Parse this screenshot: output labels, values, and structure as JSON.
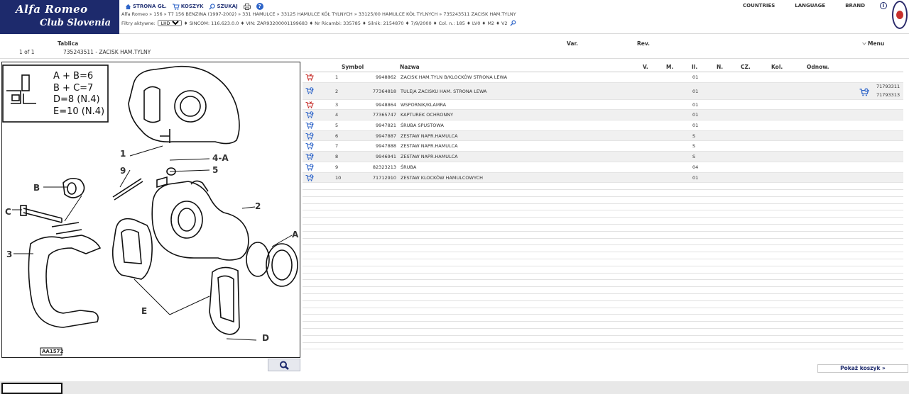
{
  "logo": {
    "line1": "Alfa Romeo",
    "line2": "Club Slovenia"
  },
  "nav": {
    "home": "STRONA GŁ.",
    "cart": "KOSZYK",
    "search": "SZUKAJ",
    "help": "?"
  },
  "right_nav": {
    "countries": "COUNTRIES",
    "language": "LANGUAGE",
    "brand": "BRAND",
    "info": "i"
  },
  "breadcrumb": "Alfa Romeo » 156 » T7 156 BENZINA (1997-2002) » 331 HAMULCE » 33125 HAMULCE KÓŁ TYLNYCH » 33125/00 HAMULCE KÓŁ TYLNYCH » 735243511 ZACISK HAM.TYLNY",
  "filters": {
    "label": "Filtry aktywne:",
    "select_value": "LHD",
    "items": "♦ SINCOM: 116.623.0.0 ♦ VIN: ZAR93200001199683 ♦ Nr Ricambi: 335785 ♦ Silnik: 2154870 ♦ 7/9/2000 ♦ Col. n.: 185 ♦ LV0 ♦ M2 ♦ V2"
  },
  "header": {
    "tablica": "Tablica",
    "var": "Var.",
    "rev": "Rev.",
    "menu": "Menu",
    "page": "1 of 1",
    "table_title": "735243511 - ZACISK HAM.TYLNY"
  },
  "diagram": {
    "legend": [
      "A + B=6",
      "B + C=7",
      "D=8  (N.4)",
      "E=10  (N.4)"
    ],
    "labels": {
      "l1": "1",
      "l2": "2",
      "l3": "3",
      "l4a": "4-A",
      "l5": "5",
      "l9": "9",
      "la": "A",
      "lb": "B",
      "lc": "C",
      "ld": "D",
      "le": "E"
    },
    "code": "AA1572"
  },
  "table": {
    "columns": {
      "symbol": "Symbol",
      "nazwa": "Nazwa",
      "v": "V.",
      "m": "M.",
      "il": "Il.",
      "n": "N.",
      "cz": "CZ.",
      "kol": "Kol.",
      "odnow": "Odnow."
    },
    "rows": [
      {
        "num": "1",
        "symbol": "9948862",
        "nazwa": "ZACISK HAM.TYLN B/KLOCKÓW STRONA LEWA",
        "il": "01"
      },
      {
        "num": "2",
        "symbol": "77364818",
        "nazwa": "TULEJA ZACISKU HAM. STRONA LEWA",
        "il": "01",
        "odnow1": "71793311",
        "odnow2": "71793313"
      },
      {
        "num": "3",
        "symbol": "9948864",
        "nazwa": "WSPORNIK/KLAMRA",
        "il": "01"
      },
      {
        "num": "4",
        "symbol": "77365747",
        "nazwa": "KAPTUREK OCHRONNY",
        "il": "01"
      },
      {
        "num": "5",
        "symbol": "9947821",
        "nazwa": "ŚRUBA SPUSTOWA",
        "il": "01"
      },
      {
        "num": "6",
        "symbol": "9947887",
        "nazwa": "ZESTAW NAPR.HAMULCA",
        "il": "S"
      },
      {
        "num": "7",
        "symbol": "9947888",
        "nazwa": "ZESTAW NAPR.HAMULCA",
        "il": "S"
      },
      {
        "num": "8",
        "symbol": "9946941",
        "nazwa": "ZESTAW NAPR.HAMULCA",
        "il": "S"
      },
      {
        "num": "9",
        "symbol": "82323213",
        "nazwa": "ŚRUBA",
        "il": "04"
      },
      {
        "num": "10",
        "symbol": "71712910",
        "nazwa": "ZESTAW KLOCKÓW HAMULCOWYCH",
        "il": "01"
      }
    ]
  },
  "basket_button": "Pokaż koszyk »",
  "colors": {
    "brand_navy": "#1d2a6c",
    "row_alt": "#f0f0f0",
    "cart_blue": "#2f65c8",
    "cart_red": "#c7302c"
  }
}
